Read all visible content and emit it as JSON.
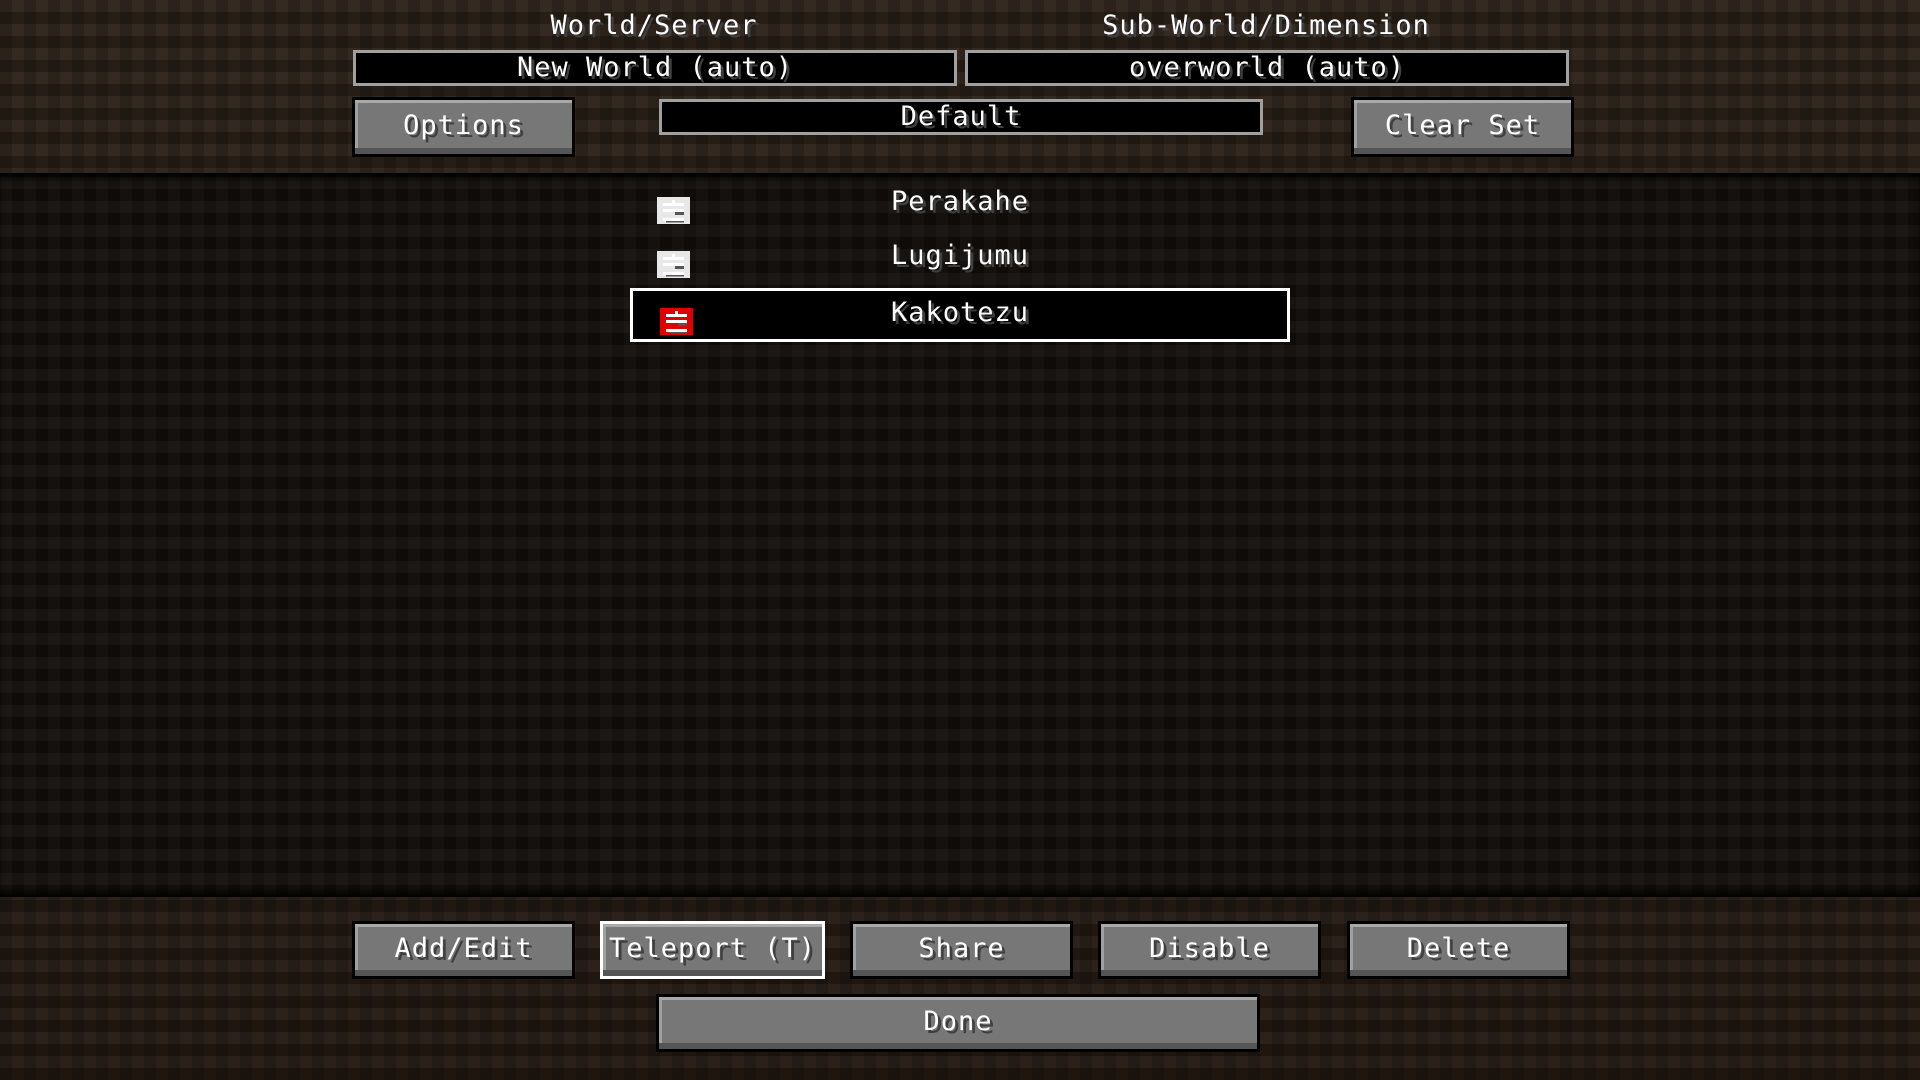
{
  "header": {
    "world_label": "World/Server",
    "world_value": "New World (auto)",
    "subworld_label": "Sub-World/Dimension",
    "subworld_value": "overworld (auto)",
    "set_value": "Default",
    "options_button": "Options",
    "clear_set_button": "Clear Set"
  },
  "waypoints": [
    {
      "name": "Perakahe",
      "color": "#e8e8e8",
      "selected": false
    },
    {
      "name": "Lugijumu",
      "color": "#e8e8e8",
      "selected": false
    },
    {
      "name": "Kakotezu",
      "color": "#e00000",
      "selected": true
    }
  ],
  "footer": {
    "buttons": [
      "Add/Edit",
      "Teleport (T)",
      "Share",
      "Disable",
      "Delete"
    ],
    "done_button": "Done"
  }
}
